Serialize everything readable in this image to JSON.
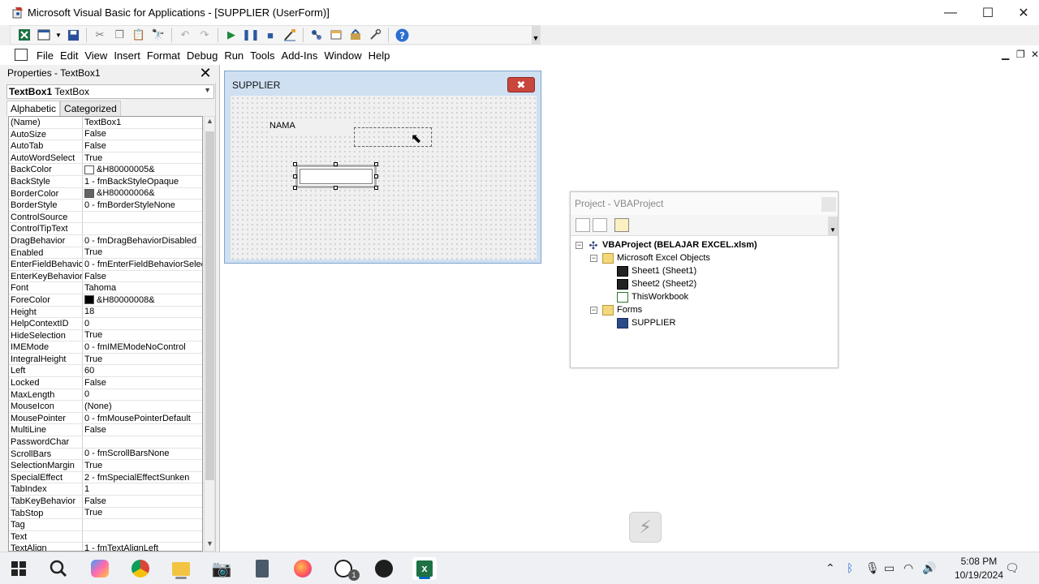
{
  "window": {
    "title": "Microsoft Visual Basic for Applications - [SUPPLIER (UserForm)]",
    "minimize": "—",
    "maximize": "☐",
    "close": "✕"
  },
  "menu": {
    "items": [
      "File",
      "Edit",
      "View",
      "Insert",
      "Format",
      "Debug",
      "Run",
      "Tools",
      "Add-Ins",
      "Window",
      "Help"
    ]
  },
  "properties": {
    "title": "Properties - TextBox1",
    "object_name": "TextBox1",
    "object_type": "TextBox",
    "tabs": [
      "Alphabetic",
      "Categorized"
    ],
    "rows": [
      {
        "name": "(Name)",
        "value": "TextBox1"
      },
      {
        "name": "AutoSize",
        "value": "False"
      },
      {
        "name": "AutoTab",
        "value": "False"
      },
      {
        "name": "AutoWordSelect",
        "value": "True"
      },
      {
        "name": "BackColor",
        "value": "&H80000005&",
        "swatch": "#ffffff"
      },
      {
        "name": "BackStyle",
        "value": "1 - fmBackStyleOpaque"
      },
      {
        "name": "BorderColor",
        "value": "&H80000006&",
        "swatch": "#646464"
      },
      {
        "name": "BorderStyle",
        "value": "0 - fmBorderStyleNone"
      },
      {
        "name": "ControlSource",
        "value": ""
      },
      {
        "name": "ControlTipText",
        "value": ""
      },
      {
        "name": "DragBehavior",
        "value": "0 - fmDragBehaviorDisabled"
      },
      {
        "name": "Enabled",
        "value": "True"
      },
      {
        "name": "EnterFieldBehavior",
        "value": "0 - fmEnterFieldBehaviorSelec"
      },
      {
        "name": "EnterKeyBehavior",
        "value": "False"
      },
      {
        "name": "Font",
        "value": "Tahoma"
      },
      {
        "name": "ForeColor",
        "value": "&H80000008&",
        "swatch": "#000000"
      },
      {
        "name": "Height",
        "value": "18"
      },
      {
        "name": "HelpContextID",
        "value": "0"
      },
      {
        "name": "HideSelection",
        "value": "True"
      },
      {
        "name": "IMEMode",
        "value": "0 - fmIMEModeNoControl"
      },
      {
        "name": "IntegralHeight",
        "value": "True"
      },
      {
        "name": "Left",
        "value": "60"
      },
      {
        "name": "Locked",
        "value": "False"
      },
      {
        "name": "MaxLength",
        "value": "0"
      },
      {
        "name": "MouseIcon",
        "value": "(None)"
      },
      {
        "name": "MousePointer",
        "value": "0 - fmMousePointerDefault"
      },
      {
        "name": "MultiLine",
        "value": "False"
      },
      {
        "name": "PasswordChar",
        "value": ""
      },
      {
        "name": "ScrollBars",
        "value": "0 - fmScrollBarsNone"
      },
      {
        "name": "SelectionMargin",
        "value": "True"
      },
      {
        "name": "SpecialEffect",
        "value": "2 - fmSpecialEffectSunken"
      },
      {
        "name": "TabIndex",
        "value": "1"
      },
      {
        "name": "TabKeyBehavior",
        "value": "False"
      },
      {
        "name": "TabStop",
        "value": "True"
      },
      {
        "name": "Tag",
        "value": ""
      },
      {
        "name": "Text",
        "value": ""
      },
      {
        "name": "TextAlign",
        "value": "1 - fmTextAlignLeft"
      }
    ]
  },
  "userform": {
    "title": "SUPPLIER",
    "label_text": "NAMA",
    "close_glyph": "✖"
  },
  "project": {
    "title": "Project - VBAProject",
    "tree": [
      {
        "label": "VBAProject (BELAJAR EXCEL.xlsm)",
        "level": 0,
        "icon": "project-icon",
        "expander": "−",
        "bold": true
      },
      {
        "label": "Microsoft Excel Objects",
        "level": 1,
        "icon": "folder-icon",
        "expander": "−"
      },
      {
        "label": "Sheet1 (Sheet1)",
        "level": 2,
        "icon": "sheet-icon"
      },
      {
        "label": "Sheet2 (Sheet2)",
        "level": 2,
        "icon": "sheet-icon"
      },
      {
        "label": "ThisWorkbook",
        "level": 2,
        "icon": "workbook-icon"
      },
      {
        "label": "Forms",
        "level": 1,
        "icon": "folder-icon",
        "expander": "−"
      },
      {
        "label": "SUPPLIER",
        "level": 2,
        "icon": "form-icon"
      }
    ]
  },
  "taskbar": {
    "time": "5:08 PM",
    "date": "10/19/2024",
    "whatsapp_badge": "1"
  },
  "colors": {
    "form_border": "#7fa6cc",
    "close_red": "#c9463d",
    "taskbar_accent": "#0067c0"
  }
}
